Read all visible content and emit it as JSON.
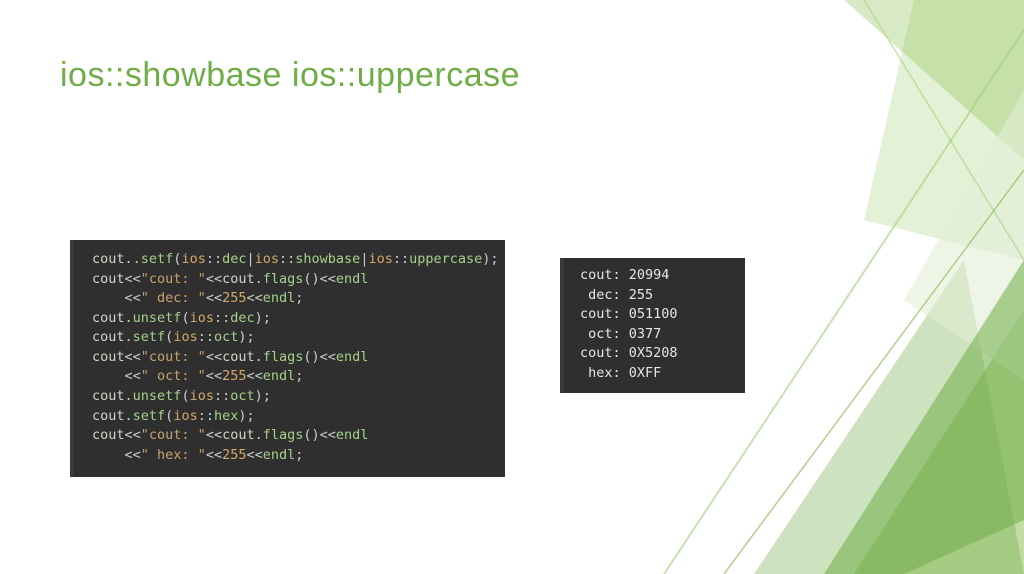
{
  "title": "ios::showbase ios::uppercase",
  "code": {
    "l1a": "cout",
    "l1b": ".setf",
    "l1c": "(ios",
    "l1d": "::",
    "l1e": "dec",
    "l1f": "|ios",
    "l1g": "::",
    "l1h": "showbase",
    "l1i": "|ios",
    "l1j": "::",
    "l1k": "uppercase",
    "l1l": ");",
    "l2a": "cout",
    "l2b": "<<",
    "l2c": "\"cout: \"",
    "l2d": "<<",
    "l2e": "cout",
    "l2f": ".flags",
    "l2g": "()<<",
    "l2h": "endl",
    "l3a": "    <<",
    "l3b": "\" dec: \"",
    "l3c": "<<",
    "l3d": "255",
    "l3e": "<<",
    "l3f": "endl",
    "l3g": ";",
    "l4a": "cout",
    "l4b": ".unsetf",
    "l4c": "(ios",
    "l4d": "::",
    "l4e": "dec",
    "l4f": ");",
    "l5a": "cout",
    "l5b": ".setf",
    "l5c": "(ios",
    "l5d": "::",
    "l5e": "oct",
    "l5f": ");",
    "l6a": "cout",
    "l6b": "<<",
    "l6c": "\"cout: \"",
    "l6d": "<<",
    "l6e": "cout",
    "l6f": ".flags",
    "l6g": "()<<",
    "l6h": "endl",
    "l7a": "    <<",
    "l7b": "\" oct: \"",
    "l7c": "<<",
    "l7d": "255",
    "l7e": "<<",
    "l7f": "endl",
    "l7g": ";",
    "l8a": "cout",
    "l8b": ".unsetf",
    "l8c": "(ios",
    "l8d": "::",
    "l8e": "oct",
    "l8f": ");",
    "l9a": "cout",
    "l9b": ".setf",
    "l9c": "(ios",
    "l9d": "::",
    "l9e": "hex",
    "l9f": ");",
    "l10a": "cout",
    "l10b": "<<",
    "l10c": "\"cout: \"",
    "l10d": "<<",
    "l10e": "cout",
    "l10f": ".flags",
    "l10g": "()<<",
    "l10h": "endl",
    "l11a": "    <<",
    "l11b": "\" hex: \"",
    "l11c": "<<",
    "l11d": "255",
    "l11e": "<<",
    "l11f": "endl",
    "l11g": ";"
  },
  "output": {
    "r1a": "cout: ",
    "r1b": "20994",
    "r2a": " dec: ",
    "r2b": "255",
    "r3a": "cout: ",
    "r3b": "051100",
    "r4a": " oct: ",
    "r4b": "0377",
    "r5a": "cout: ",
    "r5b": "0X5208",
    "r6a": " hex: ",
    "r6b": "0XFF"
  }
}
